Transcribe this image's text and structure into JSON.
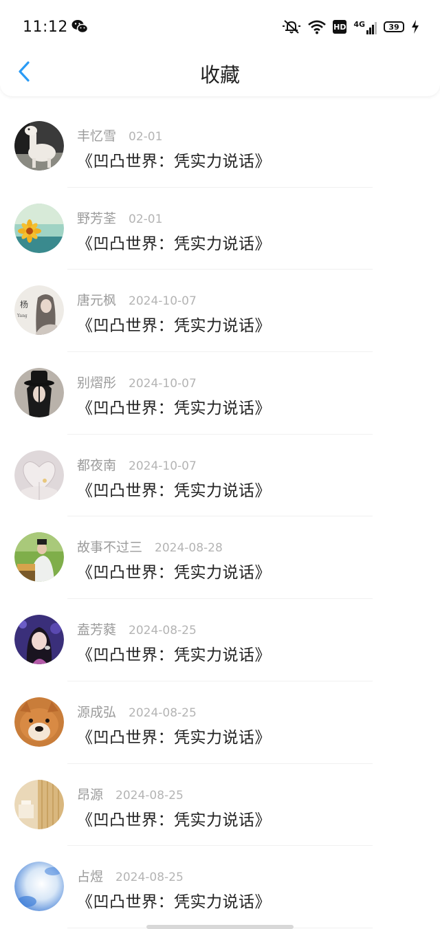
{
  "status_bar": {
    "time": "11:12",
    "network": "4G",
    "hd": "HD",
    "battery": "39"
  },
  "header": {
    "title": "收藏"
  },
  "items": [
    {
      "name": "丰忆雪",
      "date": "02-01",
      "title": "《凹凸世界：凭实力说话》",
      "avatar": "alpaca"
    },
    {
      "name": "野芳荃",
      "date": "02-01",
      "title": "《凹凸世界：凭实力说话》",
      "avatar": "sunflower"
    },
    {
      "name": "唐元枫",
      "date": "2024-10-07",
      "title": "《凹凸世界：凭实力说话》",
      "avatar": "calligraphy-girl"
    },
    {
      "name": "别熠彤",
      "date": "2024-10-07",
      "title": "《凹凸世界：凭实力说话》",
      "avatar": "hat-man"
    },
    {
      "name": "都夜南",
      "date": "2024-10-07",
      "title": "《凹凸世界：凭实力说话》",
      "avatar": "book-heart"
    },
    {
      "name": "故事不过三",
      "date": "2024-08-28",
      "title": "《凹凸世界：凭实力说话》",
      "avatar": "costume-man"
    },
    {
      "name": "盍芳蕤",
      "date": "2024-08-25",
      "title": "《凹凸世界：凭实力说话》",
      "avatar": "singer"
    },
    {
      "name": "源成弘",
      "date": "2024-08-25",
      "title": "《凹凸世界：凭实力说话》",
      "avatar": "shiba-dog"
    },
    {
      "name": "昂源",
      "date": "2024-08-25",
      "title": "《凹凸世界：凭实力说话》",
      "avatar": "curtain-room"
    },
    {
      "name": "占煜",
      "date": "2024-08-25",
      "title": "《凹凸世界：凭实力说话》",
      "avatar": "blue-sky"
    }
  ],
  "colors": {
    "accent": "#2a9bf5",
    "name_text": "#9b9b9b",
    "date_text": "#b4b4b4",
    "title_text": "#222222"
  }
}
